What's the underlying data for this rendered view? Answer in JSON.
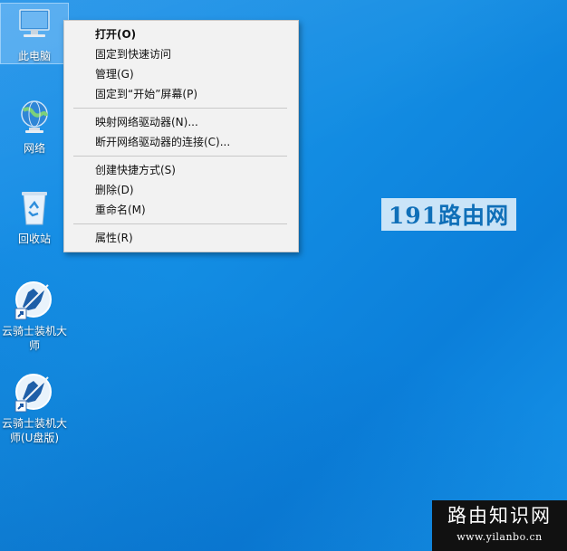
{
  "desktop": {
    "icons": [
      {
        "label": "此电脑",
        "icon": "computer-icon",
        "selected": true
      },
      {
        "label": "网络",
        "icon": "network-globe-icon"
      },
      {
        "label": "回收站",
        "icon": "recycle-bin-icon"
      },
      {
        "label": "云骑士装机大师",
        "icon": "knight-shortcut-icon"
      },
      {
        "label": "云骑士装机大师(U盘版)",
        "icon": "knight-shortcut-icon"
      }
    ]
  },
  "context_menu": {
    "items": [
      {
        "label": "打开(O)",
        "bold": true
      },
      {
        "label": "固定到快速访问"
      },
      {
        "label": "管理(G)"
      },
      {
        "label": "固定到“开始”屏幕(P)"
      },
      {
        "label": "映射网络驱动器(N)..."
      },
      {
        "label": "断开网络驱动器的连接(C)..."
      },
      {
        "label": "创建快捷方式(S)"
      },
      {
        "label": "删除(D)"
      },
      {
        "label": "重命名(M)"
      },
      {
        "label": "属性(R)"
      }
    ]
  },
  "watermarks": {
    "center_text": "191路由网",
    "corner_title": "路由知识网",
    "corner_url": "www.yilanbo.cn"
  },
  "colors": {
    "desktop_bg": "#138de3",
    "menu_bg": "#f2f2f2",
    "watermark_text": "#0f6fb8"
  }
}
